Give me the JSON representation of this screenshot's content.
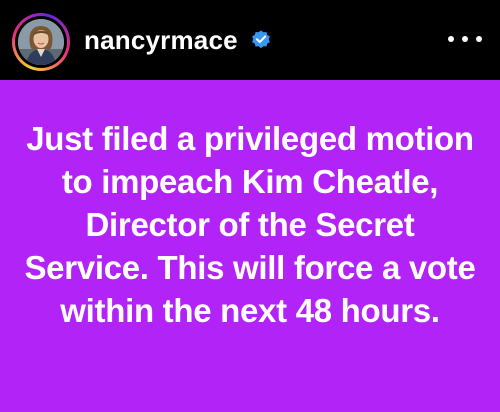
{
  "header": {
    "username": "nancyrmace",
    "verified": true,
    "avatar_icon": "profile-photo",
    "more_icon": "more-horizontal-icon"
  },
  "post": {
    "text": "Just filed a privileged motion to impeach Kim Cheatle, Director of the Secret Service. This will force a vote within the next 48 hours.",
    "background_color": "#b123f7",
    "text_color": "#ffffff"
  },
  "colors": {
    "header_background": "#000000",
    "verified_badge": "#3897f0"
  }
}
